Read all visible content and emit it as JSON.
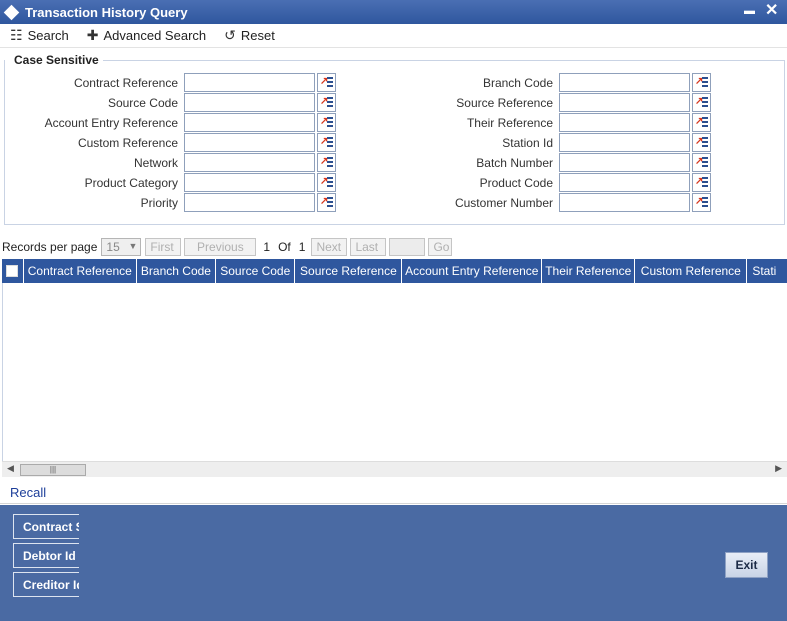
{
  "window": {
    "title": "Transaction History Query",
    "minimize": "▬",
    "close": "✕"
  },
  "toolbar": {
    "search": "Search",
    "advanced_search": "Advanced Search",
    "reset": "Reset"
  },
  "section": {
    "title": "Case Sensitive"
  },
  "fields_left": [
    {
      "label": "Contract Reference",
      "value": ""
    },
    {
      "label": "Source Code",
      "value": ""
    },
    {
      "label": "Account Entry Reference",
      "value": ""
    },
    {
      "label": "Custom Reference",
      "value": ""
    },
    {
      "label": "Network",
      "value": ""
    },
    {
      "label": "Product Category",
      "value": ""
    },
    {
      "label": "Priority",
      "value": ""
    }
  ],
  "fields_right": [
    {
      "label": "Branch Code",
      "value": ""
    },
    {
      "label": "Source Reference",
      "value": ""
    },
    {
      "label": "Their Reference",
      "value": ""
    },
    {
      "label": "Station Id",
      "value": ""
    },
    {
      "label": "Batch Number",
      "value": ""
    },
    {
      "label": "Product Code",
      "value": ""
    },
    {
      "label": "Customer Number",
      "value": ""
    }
  ],
  "pager": {
    "records_label": "Records per page",
    "records_value": "15",
    "first": "First",
    "previous": "Previous",
    "page": "1",
    "of": "Of",
    "total": "1",
    "next": "Next",
    "last": "Last",
    "go": "Go"
  },
  "grid": {
    "columns": [
      "Contract Reference",
      "Branch Code",
      "Source Code",
      "Source Reference",
      "Account Entry Reference",
      "Their Reference",
      "Custom Reference",
      "Stati"
    ]
  },
  "recall": "Recall",
  "footer": {
    "buttons": [
      "Contract S",
      "Debtor Id",
      "Creditor Id"
    ],
    "exit": "Exit"
  }
}
